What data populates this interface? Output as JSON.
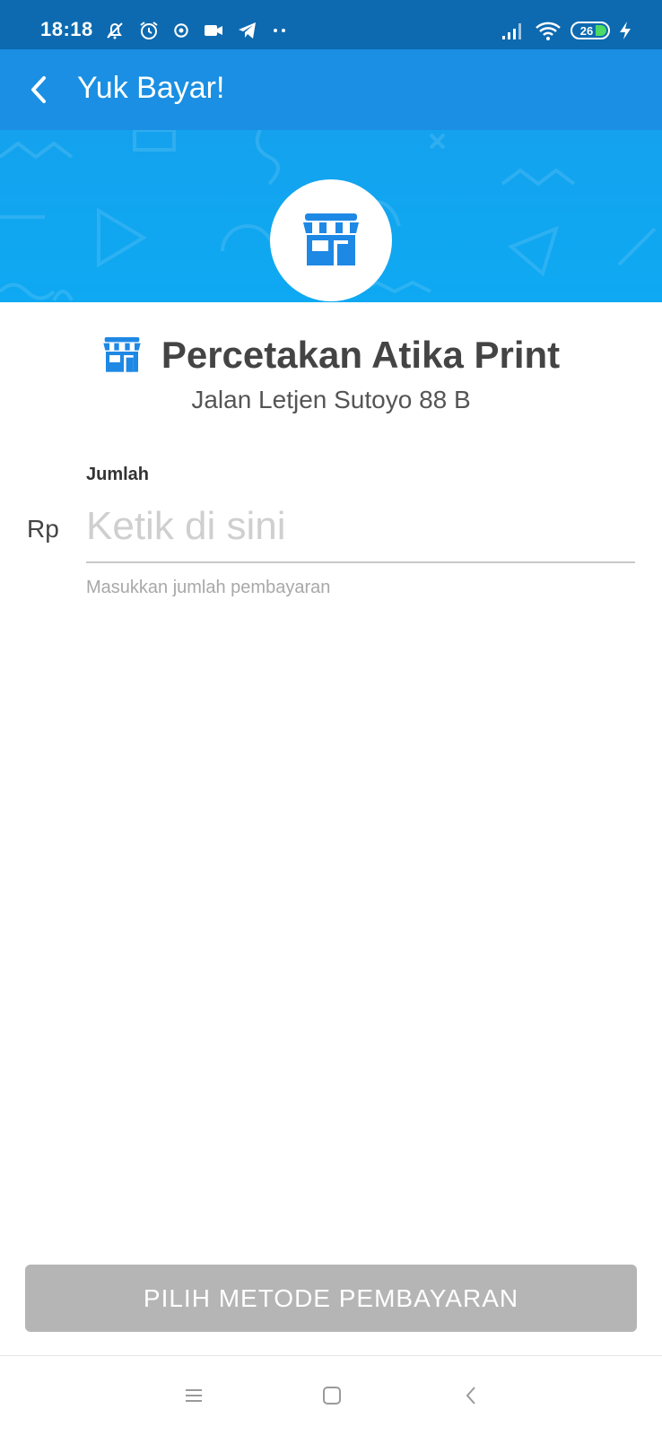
{
  "status_bar": {
    "time": "18:18",
    "battery_level": "26",
    "icons_left": [
      "mute-icon",
      "alarm-icon",
      "chat-bubble-icon",
      "video-icon",
      "telegram-icon",
      "more-dots-icon"
    ],
    "icons_right": [
      "signal-icon",
      "wifi-icon",
      "battery-icon",
      "charging-icon"
    ]
  },
  "app_bar": {
    "title": "Yuk Bayar!",
    "back_icon": "chevron-left-icon"
  },
  "merchant": {
    "name": "Percetakan Atika Print",
    "address": "Jalan Letjen Sutoyo 88 B",
    "icon": "store-icon"
  },
  "form": {
    "label": "Jumlah",
    "currency": "Rp",
    "placeholder": "Ketik di sini",
    "value": "",
    "helper": "Masukkan jumlah pembayaran"
  },
  "actions": {
    "primary_label": "PILIH METODE PEMBAYARAN"
  },
  "nav_bar": {
    "icons": [
      "menu-icon",
      "home-square-icon",
      "back-chevron-icon"
    ]
  },
  "colors": {
    "status_bar": "#0d6ab0",
    "app_bar": "#1a8fe3",
    "hero": "#14a2ee",
    "store_icon": "#1e88e5",
    "button_disabled": "#b5b5b5"
  }
}
